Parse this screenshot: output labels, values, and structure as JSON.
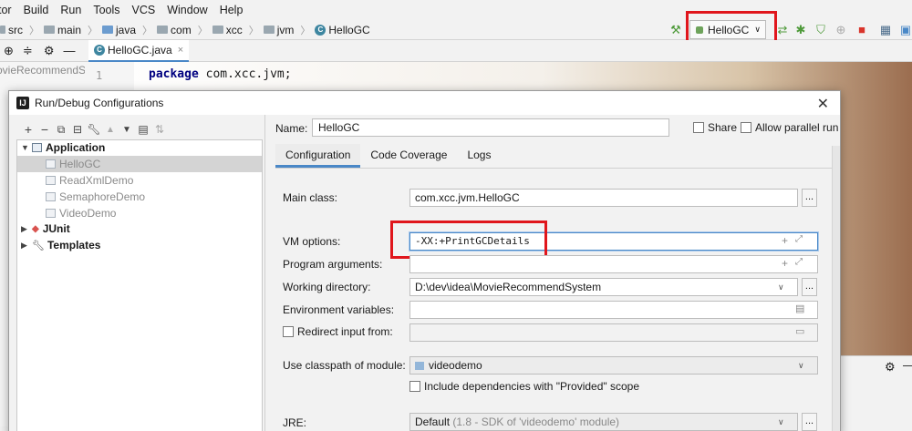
{
  "menu": [
    "tor",
    "Build",
    "Run",
    "Tools",
    "VCS",
    "Window",
    "Help"
  ],
  "breadcrumb": [
    "src",
    "main",
    "java",
    "com",
    "xcc",
    "jvm",
    "HelloGC"
  ],
  "run_config": {
    "label": "HelloGC",
    "chevron": "chevron-down-icon"
  },
  "editor": {
    "file_tab": "HelloGC.java",
    "side_label": "ovieRecommendS",
    "line_number": "1",
    "code_keyword": "package",
    "code_rest": " com.xcc.jvm;"
  },
  "dialog": {
    "title": "Run/Debug Configurations",
    "tree": {
      "application": "Application",
      "configs": [
        "HelloGC",
        "ReadXmlDemo",
        "SemaphoreDemo",
        "VideoDemo"
      ],
      "junit": "JUnit",
      "templates": "Templates"
    },
    "name_label": "Name:",
    "name_value": "HelloGC",
    "share_label": "Share",
    "parallel_label": "Allow parallel run",
    "tabs": [
      "Configuration",
      "Code Coverage",
      "Logs"
    ],
    "fields": {
      "main_class_label": "Main class:",
      "main_class_value": "com.xcc.jvm.HelloGC",
      "vm_options_label": "VM options:",
      "vm_options_value": "-XX:+PrintGCDetails",
      "program_args_label": "Program arguments:",
      "program_args_value": "",
      "working_dir_label": "Working directory:",
      "working_dir_value": "D:\\dev\\idea\\MovieRecommendSystem",
      "env_vars_label": "Environment variables:",
      "env_vars_value": "",
      "redirect_label": "Redirect input from:",
      "classpath_label": "Use classpath of module:",
      "classpath_value": "videodemo",
      "include_deps_label": "Include dependencies with \"Provided\" scope",
      "jre_label": "JRE:",
      "jre_value": "Default",
      "jre_hint": "(1.8 - SDK of 'videodemo' module)",
      "ellipsis": "..."
    }
  },
  "colors": {
    "highlight_box": "#e0161c",
    "accent": "#4a88c7"
  }
}
